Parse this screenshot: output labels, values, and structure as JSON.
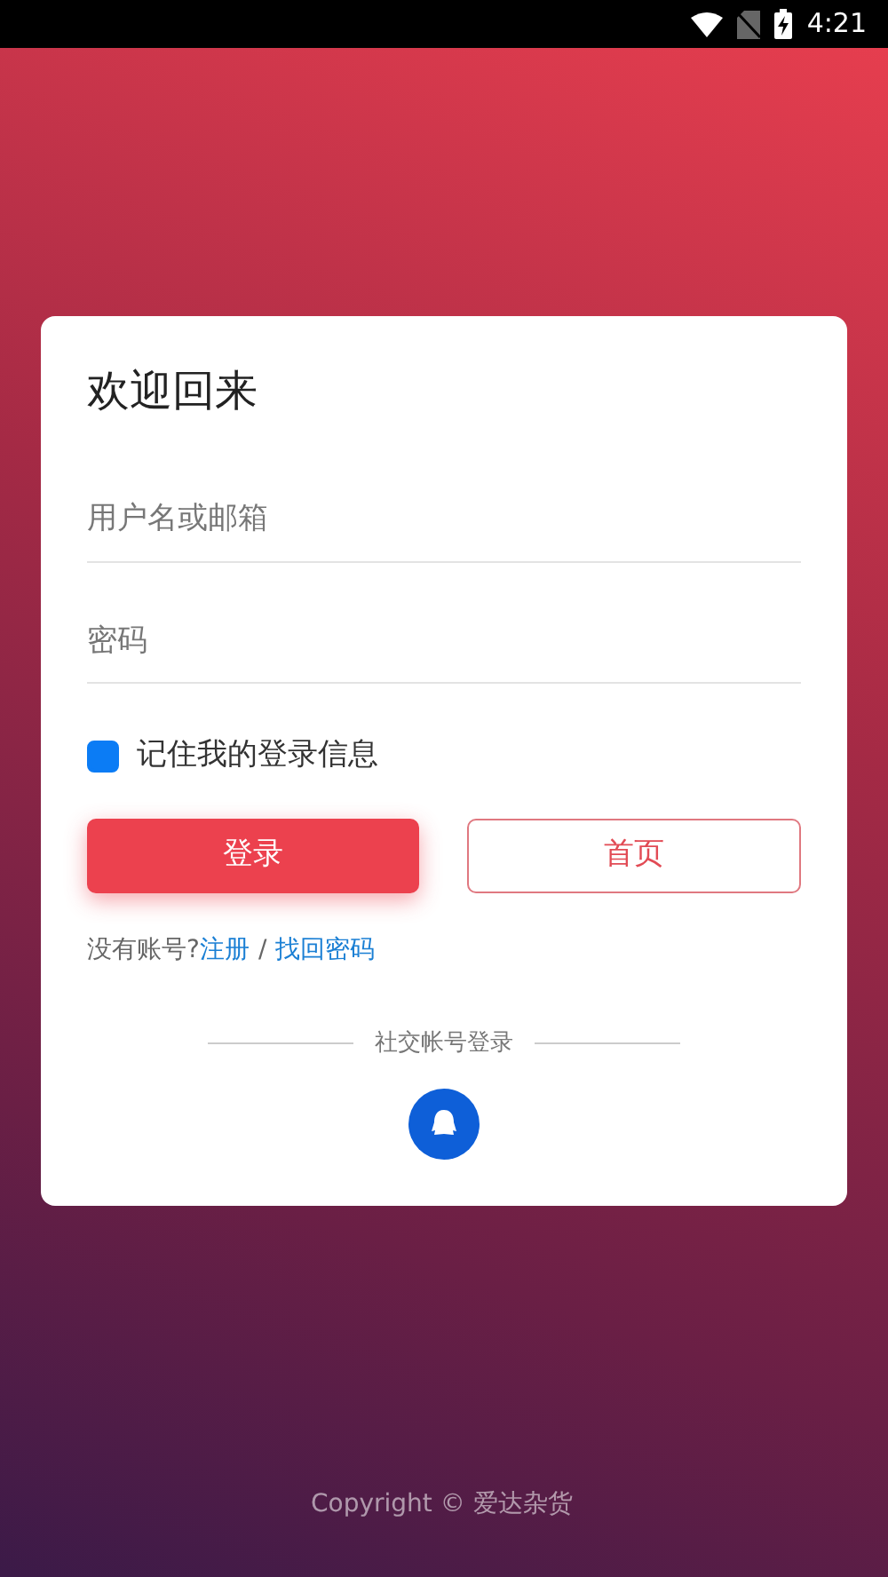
{
  "status_bar": {
    "time": "4:21"
  },
  "login": {
    "title": "欢迎回来",
    "fields": [
      {
        "placeholder": "用户名或邮箱"
      },
      {
        "placeholder": "密码"
      }
    ],
    "remember": {
      "label": "记住我的登录信息",
      "checked": true
    },
    "buttons": [
      {
        "label": "登录",
        "kind": "primary"
      },
      {
        "label": "首页",
        "kind": "outline"
      }
    ],
    "links": {
      "prompt": "没有账号?",
      "register": "注册",
      "separator": "/",
      "forgot": "找回密码"
    },
    "social": {
      "label": "社交帐号登录"
    }
  },
  "footer": "Copyright © 爱达杂货"
}
